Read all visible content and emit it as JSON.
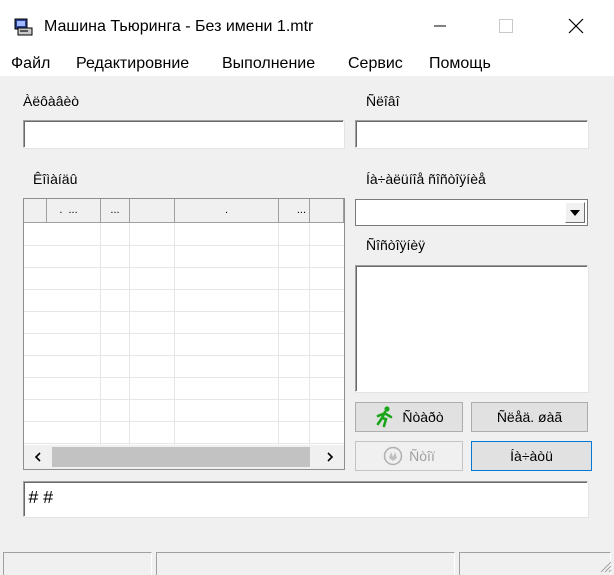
{
  "window": {
    "title": "Машина Тьюринга - Без имени 1.mtr",
    "icon": "floppy-computer-icon"
  },
  "menu": {
    "items": [
      {
        "label": "Файл"
      },
      {
        "label": "Редактировние"
      },
      {
        "label": "Выполнение"
      },
      {
        "label": "Сервис"
      },
      {
        "label": "Помощь"
      }
    ]
  },
  "fields": {
    "alphabet_label": "Àëôàâèò",
    "alphabet_value": "",
    "states_label": "Ñëîâî",
    "states_value": "",
    "commands_label": "Êîìàíäû",
    "initial_state_label": "Íà÷àëüíîå ñîñòîÿíèå",
    "initial_state_value": "",
    "comment_label": "Ñîñòîÿíèÿ",
    "comment_value": "",
    "tape_value": "##"
  },
  "grid": {
    "headers": [
      ".",
      "...",
      "...",
      ".",
      "...",
      ""
    ]
  },
  "buttons": {
    "start": "Ñòàðò",
    "step": "Ñëåä. øàã",
    "stop": "Ñòîï",
    "reset": "Íà÷àòü"
  },
  "colors": {
    "accent_green": "#1aa51a",
    "disabled_text": "#a0a0a0"
  }
}
